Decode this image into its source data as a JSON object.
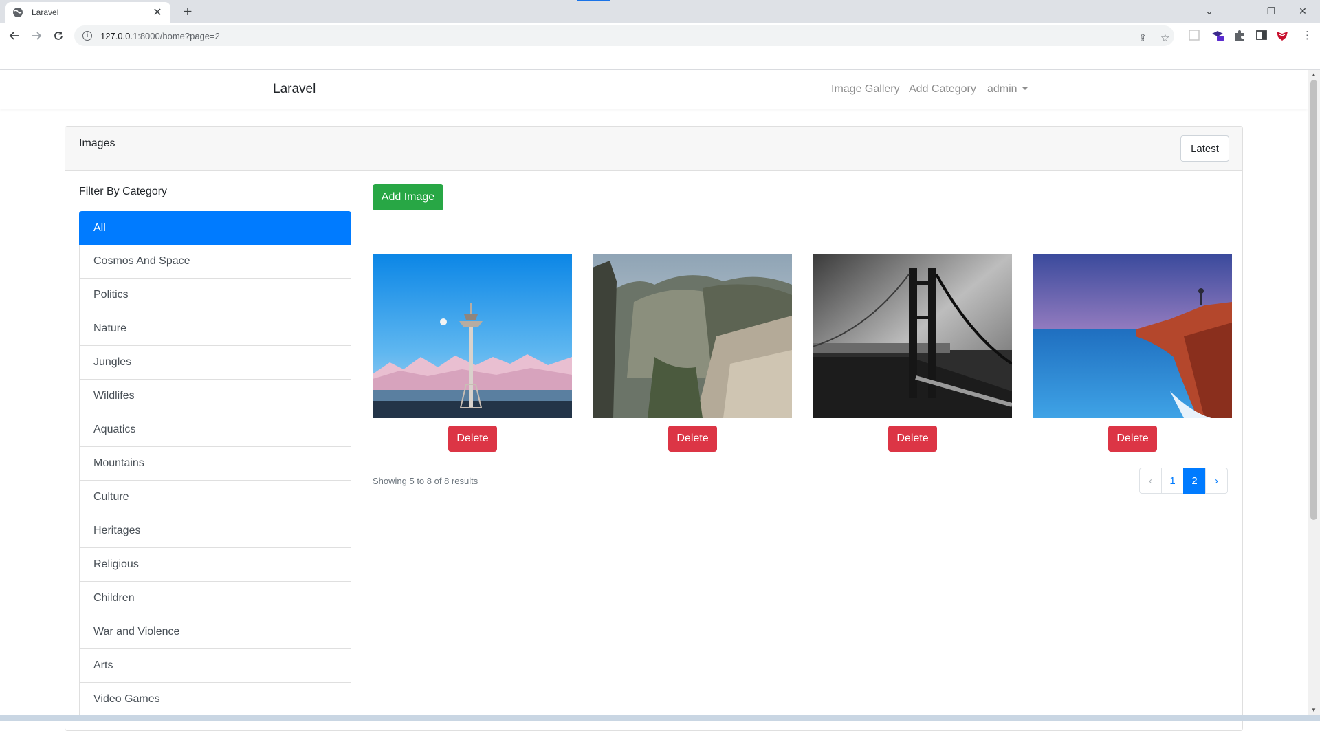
{
  "browser": {
    "tab_title": "Laravel",
    "url_host": "127.0.0.1",
    "url_rest": ":8000/home?page=2"
  },
  "navbar": {
    "brand": "Laravel",
    "links": [
      "Image Gallery",
      "Add Category"
    ],
    "user": "admin"
  },
  "card": {
    "title": "Images",
    "sort_button": "Latest"
  },
  "sidebar": {
    "title": "Filter By Category",
    "categories": [
      {
        "label": "All",
        "active": true
      },
      {
        "label": "Cosmos And Space"
      },
      {
        "label": "Politics"
      },
      {
        "label": "Nature"
      },
      {
        "label": "Jungles"
      },
      {
        "label": "Wildlifes"
      },
      {
        "label": "Aquatics"
      },
      {
        "label": "Mountains"
      },
      {
        "label": "Culture"
      },
      {
        "label": "Heritages"
      },
      {
        "label": "Religious"
      },
      {
        "label": "Children"
      },
      {
        "label": "War and Violence"
      },
      {
        "label": "Arts"
      },
      {
        "label": "Video Games"
      }
    ]
  },
  "main": {
    "add_button": "Add Image",
    "delete_label": "Delete",
    "images": [
      {
        "subject": "space-needle-tower"
      },
      {
        "subject": "canyon-valley-cliffs"
      },
      {
        "subject": "suspension-bridge-bw"
      },
      {
        "subject": "red-cliffs-ocean"
      }
    ],
    "results_text": "Showing 5 to 8 of 8 results",
    "pagination": {
      "prev": "‹",
      "pages": [
        "1",
        "2"
      ],
      "current": "2",
      "next": "›"
    }
  },
  "colors": {
    "primary": "#007bff",
    "success": "#28a745",
    "danger": "#dc3545"
  }
}
